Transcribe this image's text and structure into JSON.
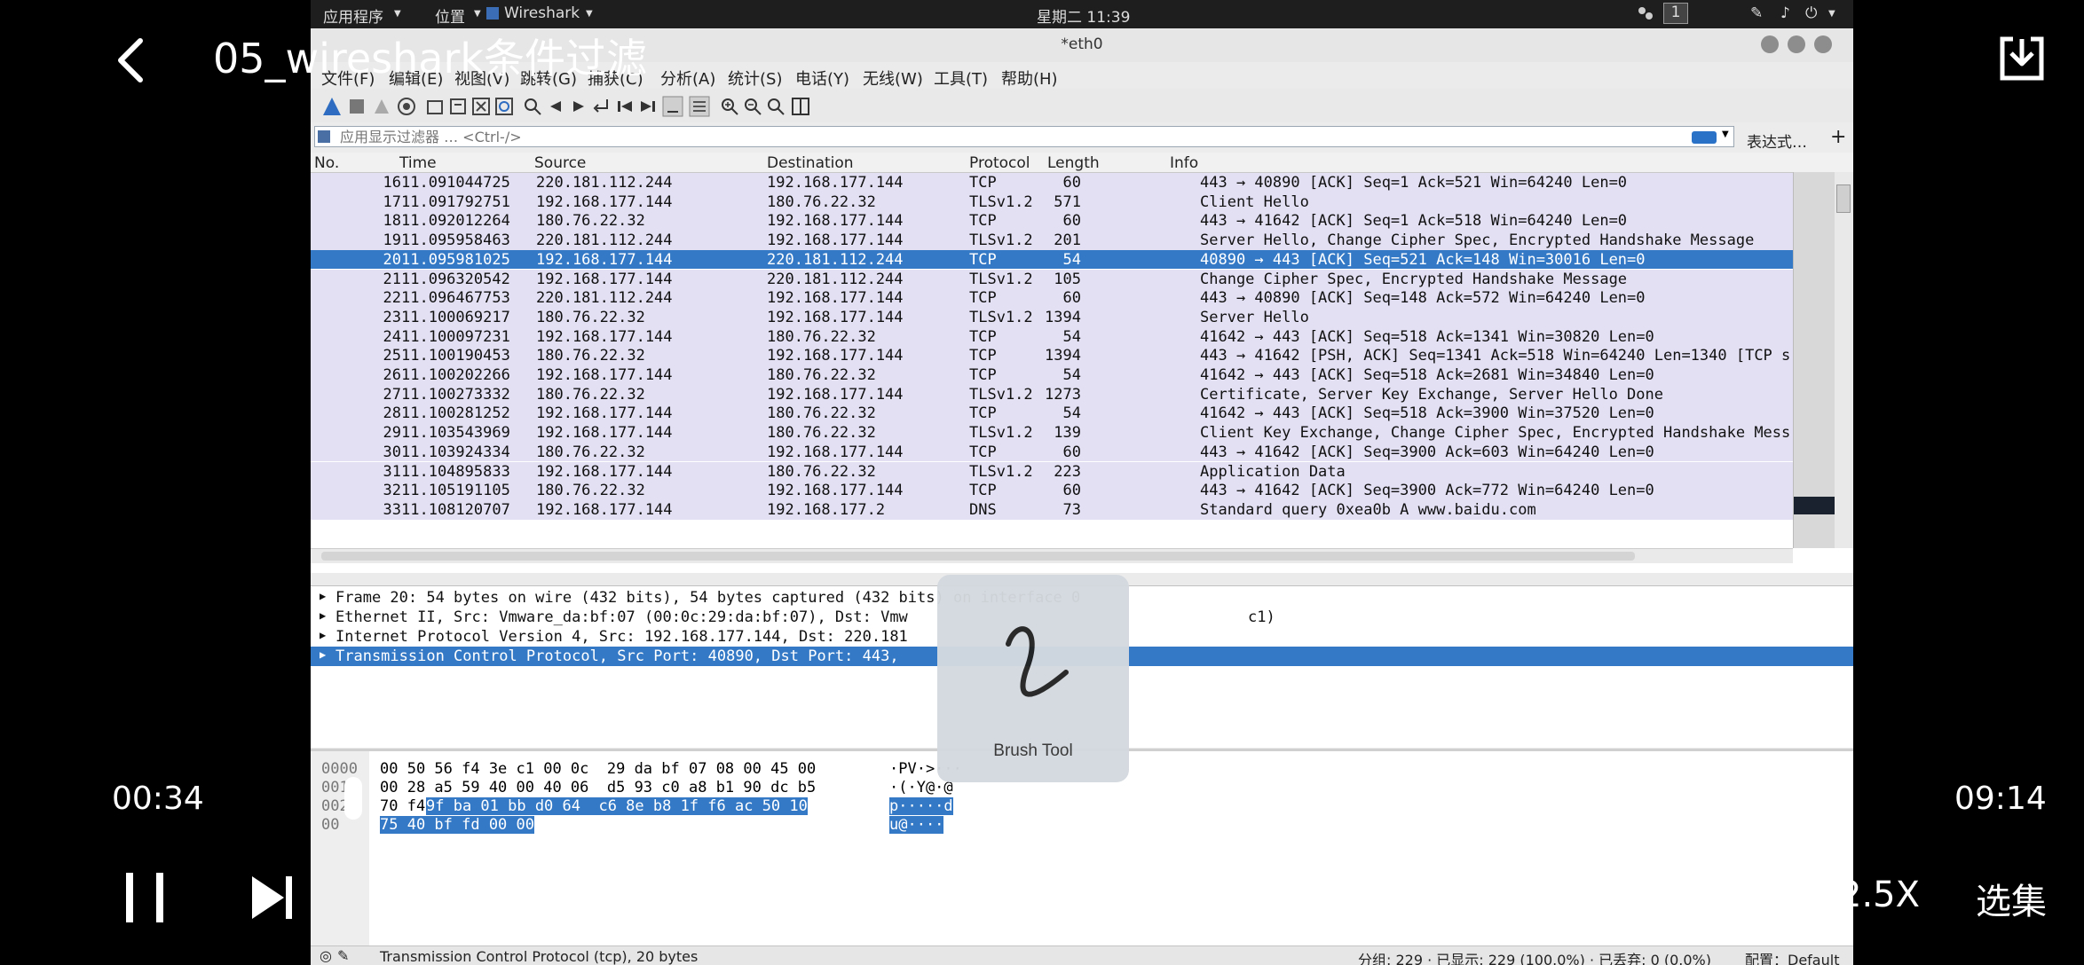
{
  "video": {
    "title": "05_wireshark条件过滤",
    "current_time": "00:34",
    "total_time": "09:14",
    "speed": "2.5X",
    "episodes": "选集",
    "icons": [
      "back-icon",
      "download-icon",
      "pause-icon",
      "next-icon"
    ]
  },
  "desktop": {
    "apps_menu": "应用程序",
    "places_menu": "位置",
    "active_app": "Wireshark",
    "clock": "星期二 11:39",
    "workspace": "1"
  },
  "window": {
    "title": "*eth0",
    "menus": [
      "文件(F)",
      "编辑(E)",
      "视图(V)",
      "跳转(G)",
      "捕获(C)",
      "分析(A)",
      "统计(S)",
      "电话(Y)",
      "无线(W)",
      "工具(T)",
      "帮助(H)"
    ]
  },
  "filter": {
    "placeholder": "应用显示过滤器 … <Ctrl-/>",
    "expression_label": "表达式…",
    "plus_label": "+"
  },
  "columns": [
    "No.",
    "Time",
    "Source",
    "Destination",
    "Protocol",
    "Length",
    "Info"
  ],
  "packets": [
    {
      "no": "16",
      "time": "11.091044725",
      "src": "220.181.112.244",
      "dst": "192.168.177.144",
      "proto": "TCP",
      "len": "60",
      "info": "443 → 40890 [ACK] Seq=1 Ack=521 Win=64240 Len=0"
    },
    {
      "no": "17",
      "time": "11.091792751",
      "src": "192.168.177.144",
      "dst": "180.76.22.32",
      "proto": "TLSv1.2",
      "len": "571",
      "info": "Client Hello"
    },
    {
      "no": "18",
      "time": "11.092012264",
      "src": "180.76.22.32",
      "dst": "192.168.177.144",
      "proto": "TCP",
      "len": "60",
      "info": "443 → 41642 [ACK] Seq=1 Ack=518 Win=64240 Len=0"
    },
    {
      "no": "19",
      "time": "11.095958463",
      "src": "220.181.112.244",
      "dst": "192.168.177.144",
      "proto": "TLSv1.2",
      "len": "201",
      "info": "Server Hello, Change Cipher Spec, Encrypted Handshake Message"
    },
    {
      "no": "20",
      "time": "11.095981025",
      "src": "192.168.177.144",
      "dst": "220.181.112.244",
      "proto": "TCP",
      "len": "54",
      "info": "40890 → 443 [ACK] Seq=521 Ack=148 Win=30016 Len=0"
    },
    {
      "no": "21",
      "time": "11.096320542",
      "src": "192.168.177.144",
      "dst": "220.181.112.244",
      "proto": "TLSv1.2",
      "len": "105",
      "info": "Change Cipher Spec, Encrypted Handshake Message"
    },
    {
      "no": "22",
      "time": "11.096467753",
      "src": "220.181.112.244",
      "dst": "192.168.177.144",
      "proto": "TCP",
      "len": "60",
      "info": "443 → 40890 [ACK] Seq=148 Ack=572 Win=64240 Len=0"
    },
    {
      "no": "23",
      "time": "11.100069217",
      "src": "180.76.22.32",
      "dst": "192.168.177.144",
      "proto": "TLSv1.2",
      "len": "1394",
      "info": "Server Hello"
    },
    {
      "no": "24",
      "time": "11.100097231",
      "src": "192.168.177.144",
      "dst": "180.76.22.32",
      "proto": "TCP",
      "len": "54",
      "info": "41642 → 443 [ACK] Seq=518 Ack=1341 Win=30820 Len=0"
    },
    {
      "no": "25",
      "time": "11.100190453",
      "src": "180.76.22.32",
      "dst": "192.168.177.144",
      "proto": "TCP",
      "len": "1394",
      "info": "443 → 41642 [PSH, ACK] Seq=1341 Ack=518 Win=64240 Len=1340 [TCP s"
    },
    {
      "no": "26",
      "time": "11.100202266",
      "src": "192.168.177.144",
      "dst": "180.76.22.32",
      "proto": "TCP",
      "len": "54",
      "info": "41642 → 443 [ACK] Seq=518 Ack=2681 Win=34840 Len=0"
    },
    {
      "no": "27",
      "time": "11.100273332",
      "src": "180.76.22.32",
      "dst": "192.168.177.144",
      "proto": "TLSv1.2",
      "len": "1273",
      "info": "Certificate, Server Key Exchange, Server Hello Done"
    },
    {
      "no": "28",
      "time": "11.100281252",
      "src": "192.168.177.144",
      "dst": "180.76.22.32",
      "proto": "TCP",
      "len": "54",
      "info": "41642 → 443 [ACK] Seq=518 Ack=3900 Win=37520 Len=0"
    },
    {
      "no": "29",
      "time": "11.103543969",
      "src": "192.168.177.144",
      "dst": "180.76.22.32",
      "proto": "TLSv1.2",
      "len": "139",
      "info": "Client Key Exchange, Change Cipher Spec, Encrypted Handshake Mess"
    },
    {
      "no": "30",
      "time": "11.103924334",
      "src": "180.76.22.32",
      "dst": "192.168.177.144",
      "proto": "TCP",
      "len": "60",
      "info": "443 → 41642 [ACK] Seq=3900 Ack=603 Win=64240 Len=0"
    },
    {
      "no": "31",
      "time": "11.104895833",
      "src": "192.168.177.144",
      "dst": "180.76.22.32",
      "proto": "TLSv1.2",
      "len": "223",
      "info": "Application Data"
    },
    {
      "no": "32",
      "time": "11.105191105",
      "src": "180.76.22.32",
      "dst": "192.168.177.144",
      "proto": "TCP",
      "len": "60",
      "info": "443 → 41642 [ACK] Seq=3900 Ack=772 Win=64240 Len=0"
    },
    {
      "no": "33",
      "time": "11.108120707",
      "src": "192.168.177.144",
      "dst": "192.168.177.2",
      "proto": "DNS",
      "len": "73",
      "info": "Standard query 0xea0b A www.baidu.com"
    }
  ],
  "details": [
    "Frame 20: 54 bytes on wire (432 bits), 54 bytes captured (432 bits) on interface 0",
    "Ethernet II, Src: Vmware_da:bf:07 (00:0c:29:da:bf:07), Dst: Vmw",
    "c1)",
    "Internet Protocol Version 4, Src: 192.168.177.144, Dst: 220.181",
    "Transmission Control Protocol, Src Port: 40890, Dst Port: 443,"
  ],
  "bytes": [
    {
      "off": "0000",
      "hex_a": "00 50 56 f4 3e c1 00 0c  29 da bf 07 08 00 45 00",
      "hex_b": "",
      "ascii": "·PV·>···"
    },
    {
      "off": "0010",
      "hex_a": "00 28 a5 59 40 00 40 06  d5 93 c0 a8 b1 90 dc b5",
      "hex_b": "",
      "ascii": "·(·Y@·@"
    },
    {
      "off": "0020",
      "hex_a": "70 f4 ",
      "hex_b": "9f ba 01 bb d0 64  c6 8e b8 1f f6 ac 50 10",
      "ascii": "p·····d"
    },
    {
      "off": "00",
      "hex_a": "",
      "hex_b": "75 40 bf fd 00 00",
      "ascii": "u@····"
    }
  ],
  "brush_tool": {
    "label": "Brush Tool"
  },
  "status": {
    "left": "Transmission Control Protocol (tcp), 20 bytes",
    "counts": "分组: 229 · 已显示: 229 (100.0%) · 已丢弃: 0 (0.0%)",
    "profile": "配置：Default"
  },
  "colors": {
    "selection": "#3479c6",
    "row_bg": "#e4e0f4",
    "background": "#000000"
  }
}
